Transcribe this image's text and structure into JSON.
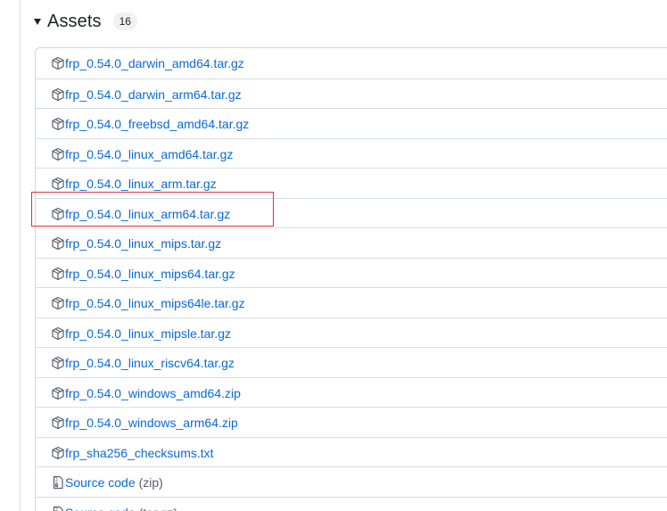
{
  "assets": {
    "title": "Assets",
    "count": "16",
    "items": [
      {
        "label": "frp_0.54.0_darwin_amd64.tar.gz",
        "icon": "package-icon"
      },
      {
        "label": "frp_0.54.0_darwin_arm64.tar.gz",
        "icon": "package-icon"
      },
      {
        "label": "frp_0.54.0_freebsd_amd64.tar.gz",
        "icon": "package-icon"
      },
      {
        "label": "frp_0.54.0_linux_amd64.tar.gz",
        "icon": "package-icon"
      },
      {
        "label": "frp_0.54.0_linux_arm.tar.gz",
        "icon": "package-icon"
      },
      {
        "label": "frp_0.54.0_linux_arm64.tar.gz",
        "icon": "package-icon",
        "highlighted": true
      },
      {
        "label": "frp_0.54.0_linux_mips.tar.gz",
        "icon": "package-icon"
      },
      {
        "label": "frp_0.54.0_linux_mips64.tar.gz",
        "icon": "package-icon"
      },
      {
        "label": "frp_0.54.0_linux_mips64le.tar.gz",
        "icon": "package-icon"
      },
      {
        "label": "frp_0.54.0_linux_mipsle.tar.gz",
        "icon": "package-icon"
      },
      {
        "label": "frp_0.54.0_linux_riscv64.tar.gz",
        "icon": "package-icon"
      },
      {
        "label": "frp_0.54.0_windows_amd64.zip",
        "icon": "package-icon"
      },
      {
        "label": "frp_0.54.0_windows_arm64.zip",
        "icon": "package-icon"
      },
      {
        "label": "frp_sha256_checksums.txt",
        "icon": "package-icon"
      },
      {
        "label": "Source code",
        "suffix": "(zip)",
        "icon": "file-zip-icon"
      },
      {
        "label": "Source code",
        "suffix": "(tar.gz)",
        "icon": "file-zip-icon"
      }
    ]
  },
  "colors": {
    "link": "#0969da",
    "highlight": "#d9363e",
    "border": "#d0d7de"
  }
}
